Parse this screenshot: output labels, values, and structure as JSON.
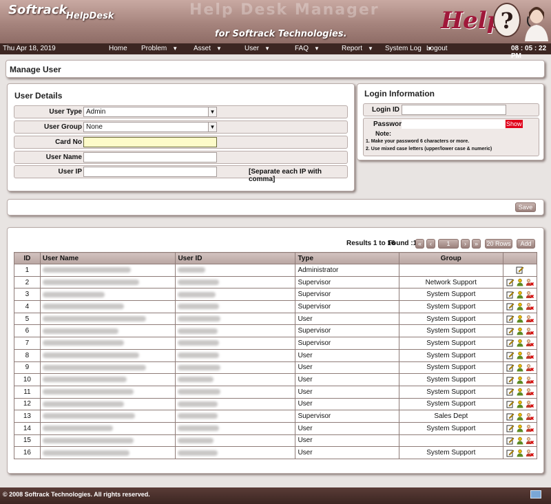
{
  "header": {
    "logo": "Softrack",
    "logo_sub": "HelpDesk",
    "watermark": "Help Desk Manager",
    "tagline": "for Softrack Technologies.",
    "help_word": "Help",
    "help_symbol": "?"
  },
  "nav": {
    "date": "Thu Apr 18, 2019",
    "items": [
      {
        "label": "Home",
        "caret": ""
      },
      {
        "label": "Problem",
        "caret": "▼"
      },
      {
        "label": "Asset",
        "caret": "▼"
      },
      {
        "label": "User",
        "caret": "▼"
      },
      {
        "label": "FAQ",
        "caret": "▼"
      },
      {
        "label": "Report",
        "caret": "▼"
      },
      {
        "label": "System Log",
        "caret": "▼"
      },
      {
        "label": "Logout",
        "caret": ""
      }
    ],
    "clock": "08 : 05 : 22 PM"
  },
  "page_title": "Manage User",
  "user_details": {
    "title": "User Details",
    "user_type_label": "User Type",
    "user_type_value": "Admin",
    "user_group_label": "User Group",
    "user_group_value": "None",
    "card_no_label": "Card No",
    "user_name_label": "User Name",
    "user_ip_label": "User IP",
    "user_ip_note": "[Separate each IP with comma]"
  },
  "login": {
    "title": "Login Information",
    "login_id_label": "Login ID",
    "password_label": "Password",
    "show_label": "Show",
    "note_label": "Note:",
    "note_1": "1. Make your password 6 characters or more.",
    "note_2": "2. Use mixed case letters (upper/lower case & numeric)"
  },
  "save_label": "Save",
  "results": {
    "summary": "Results 1 to 16",
    "found": "Found :16",
    "page": "1",
    "rows_label": "20 Rows",
    "add_label": "Add"
  },
  "table": {
    "headers": [
      "ID",
      "User Name",
      "User ID",
      "Type",
      "Group",
      ""
    ],
    "rows": [
      {
        "id": "1",
        "type": "Administrator",
        "group": "",
        "actions": 1
      },
      {
        "id": "2",
        "type": "Supervisor",
        "group": "Network Support",
        "actions": 3
      },
      {
        "id": "3",
        "type": "Supervisor",
        "group": "System Support",
        "actions": 3
      },
      {
        "id": "4",
        "type": "Supervisor",
        "group": "System Support",
        "actions": 3
      },
      {
        "id": "5",
        "type": "User",
        "group": "System Support",
        "actions": 3
      },
      {
        "id": "6",
        "type": "Supervisor",
        "group": "System Support",
        "actions": 3
      },
      {
        "id": "7",
        "type": "Supervisor",
        "group": "System Support",
        "actions": 3
      },
      {
        "id": "8",
        "type": "User",
        "group": "System Support",
        "actions": 3
      },
      {
        "id": "9",
        "type": "User",
        "group": "System Support",
        "actions": 3
      },
      {
        "id": "10",
        "type": "User",
        "group": "System Support",
        "actions": 3
      },
      {
        "id": "11",
        "type": "User",
        "group": "System Support",
        "actions": 3
      },
      {
        "id": "12",
        "type": "User",
        "group": "System Support",
        "actions": 3
      },
      {
        "id": "13",
        "type": "Supervisor",
        "group": "Sales Dept",
        "actions": 3
      },
      {
        "id": "14",
        "type": "User",
        "group": "System Support",
        "actions": 3
      },
      {
        "id": "15",
        "type": "User",
        "group": "",
        "actions": 3
      },
      {
        "id": "16",
        "type": "User",
        "group": "System Support",
        "actions": 3
      }
    ]
  },
  "footer": {
    "copyright": "© 2008  Softrack Technologies. All rights reserved."
  },
  "icons": {
    "edit": "edit-icon",
    "permission": "user-permission-icon",
    "delete": "delete-user-icon",
    "first": "first-page-icon",
    "prev": "prev-page-icon",
    "next": "next-page-icon",
    "last": "last-page-icon",
    "keyboard": "keyboard-icon"
  },
  "colors": {
    "banner": "#a6847d",
    "navbar": "#3c2622",
    "show_button": "#e0001a",
    "help_text": "#a0183a"
  }
}
